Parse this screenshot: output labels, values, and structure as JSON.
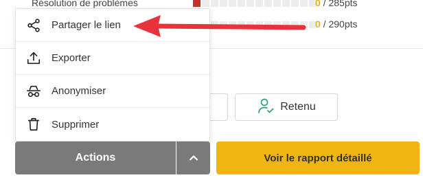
{
  "stats": [
    {
      "label": "Résolution de problèmes",
      "score": "0",
      "total": " / 285pts",
      "filled_fraction": 0.07
    },
    {
      "label": "",
      "score": "0",
      "total": " / 290pts",
      "filled_fraction": 0
    }
  ],
  "retenu_button": {
    "label": "Retenu",
    "icon": "user-check-icon"
  },
  "menu": {
    "items": [
      {
        "label": "Partager le lien",
        "icon": "share-icon"
      },
      {
        "label": "Exporter",
        "icon": "upload-icon"
      },
      {
        "label": "Anonymiser",
        "icon": "incognito-icon"
      },
      {
        "label": "Supprimer",
        "icon": "trash-icon"
      }
    ]
  },
  "actions": {
    "label": "Actions",
    "toggle_icon": "chevron-up-icon"
  },
  "report_button": {
    "label": "Voir le rapport détaillé"
  },
  "colors": {
    "accent": "#f0b512",
    "actions_bg": "#7a7a7a",
    "arrow": "#e8323c",
    "bar_filled": "#c9302c"
  }
}
